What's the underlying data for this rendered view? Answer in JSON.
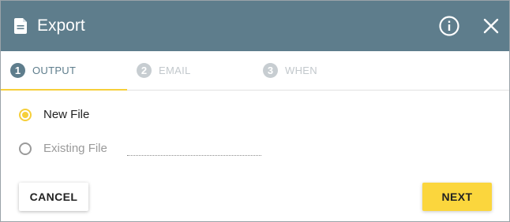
{
  "dialog": {
    "title": "Export",
    "icons": {
      "title_icon": "document-icon",
      "info": "info-icon",
      "close": "close-icon"
    },
    "colors": {
      "header_bg": "#5e7d8c",
      "accent": "#f6cf3a",
      "inactive_tab": "#c2c8cc"
    }
  },
  "tabs": [
    {
      "number": "1",
      "label": "OUTPUT",
      "active": true
    },
    {
      "number": "2",
      "label": "EMAIL",
      "active": false
    },
    {
      "number": "3",
      "label": "WHEN",
      "active": false
    }
  ],
  "output": {
    "options": [
      {
        "label": "New File",
        "selected": true
      },
      {
        "label": "Existing File",
        "selected": false
      }
    ],
    "existing_file_value": ""
  },
  "footer": {
    "cancel_label": "CANCEL",
    "next_label": "NEXT"
  }
}
